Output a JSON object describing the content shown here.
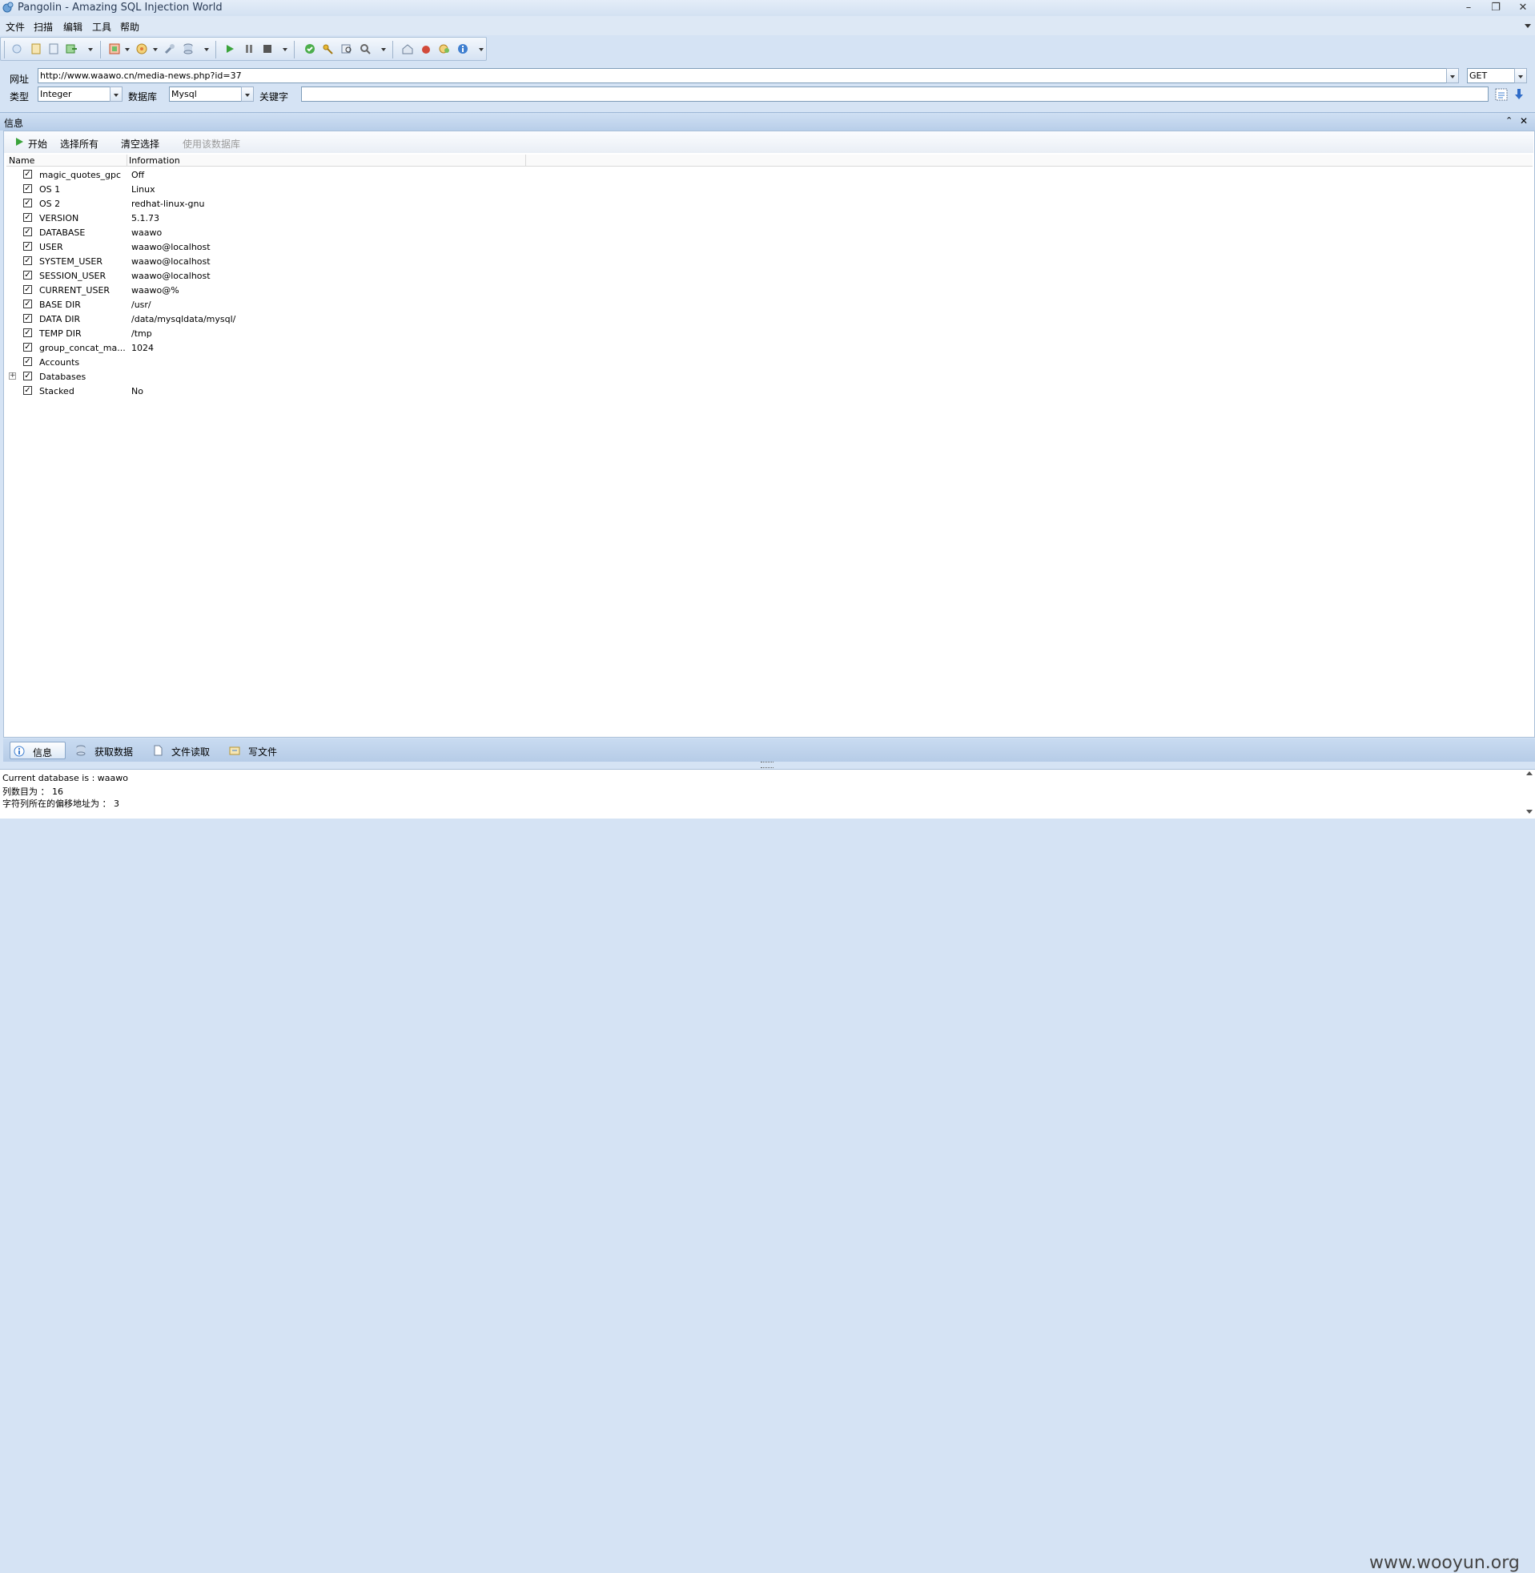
{
  "window": {
    "title": "Pangolin - Amazing SQL Injection World",
    "minimize": "–",
    "restore": "❐",
    "close": "✕"
  },
  "menu": [
    "文件",
    "扫描",
    "编辑",
    "工具",
    "帮助"
  ],
  "address": {
    "url_label": "网址",
    "url_value": "http://www.waawo.cn/media-news.php?id=37",
    "method_value": "GET",
    "type_label": "类型",
    "type_value": "Integer",
    "db_label": "数据库",
    "db_value": "Mysql",
    "keyword_label": "关键字",
    "keyword_value": ""
  },
  "panel": {
    "title": "信息",
    "pin": "⌃",
    "close": "✕",
    "actions": {
      "start": "开始",
      "select_all": "选择所有",
      "clear_select": "清空选择",
      "use_db": "使用该数据库"
    },
    "columns": [
      "Name",
      "Information"
    ],
    "rows": [
      {
        "name": "magic_quotes_gpc",
        "info": "Off"
      },
      {
        "name": "OS 1",
        "info": "Linux"
      },
      {
        "name": "OS 2",
        "info": "redhat-linux-gnu"
      },
      {
        "name": "VERSION",
        "info": "5.1.73"
      },
      {
        "name": "DATABASE",
        "info": "waawo"
      },
      {
        "name": "USER",
        "info": "waawo@localhost"
      },
      {
        "name": "SYSTEM_USER",
        "info": "waawo@localhost"
      },
      {
        "name": "SESSION_USER",
        "info": "waawo@localhost"
      },
      {
        "name": "CURRENT_USER",
        "info": "waawo@%"
      },
      {
        "name": "BASE DIR",
        "info": "/usr/"
      },
      {
        "name": "DATA DIR",
        "info": "/data/mysqldata/mysql/"
      },
      {
        "name": "TEMP DIR",
        "info": "/tmp"
      },
      {
        "name": "group_concat_ma...",
        "info": "1024"
      },
      {
        "name": "Accounts",
        "info": ""
      },
      {
        "name": "Databases",
        "info": ""
      },
      {
        "name": "Stacked",
        "info": "No"
      }
    ]
  },
  "tabs": [
    "信息",
    "获取数据",
    "文件读取",
    "写文件"
  ],
  "log": [
    "Current database is : waawo",
    "列数目为 ： 16",
    "字符列所在的偏移地址为 ： 3"
  ],
  "watermark": "www.wooyun.org",
  "colors": {
    "accent": "#d5e3f4",
    "panel_header": "#b8cee9"
  }
}
